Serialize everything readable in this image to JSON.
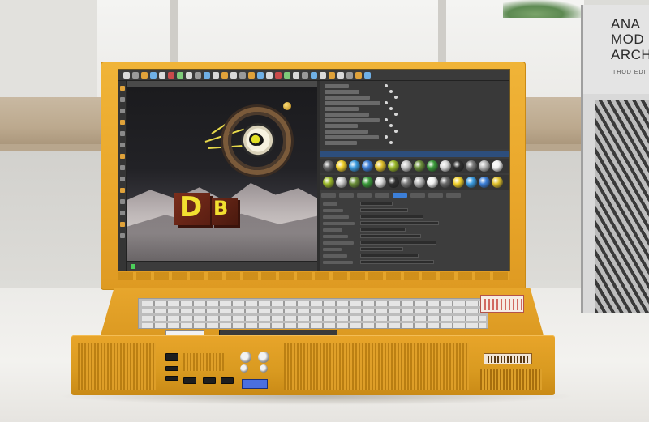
{
  "book": {
    "title_lines": [
      "ANA",
      "MOD",
      "ARCH"
    ],
    "subtitle": "THOD EDI"
  },
  "colors": {
    "laptop_body": "#e9a62a",
    "screen_bg": "#2e2e2e",
    "accent_yellow": "#f2e030",
    "led_green": "#2fc34b",
    "lcd_blue": "#4a6fe0"
  },
  "screen": {
    "viewport_glyphs": [
      "D",
      "B"
    ],
    "material_swatches": [
      "#6a6a6a",
      "#f1d02a",
      "#3a9be0",
      "#3c7fd8",
      "#e0c12b",
      "#9ab829",
      "#c8c8c8",
      "#6b8e3a",
      "#3a9a3a",
      "#d9d9d9",
      "#2f2f2f",
      "#7a7a7a",
      "#b5b5b5",
      "#f0f0f0"
    ]
  }
}
